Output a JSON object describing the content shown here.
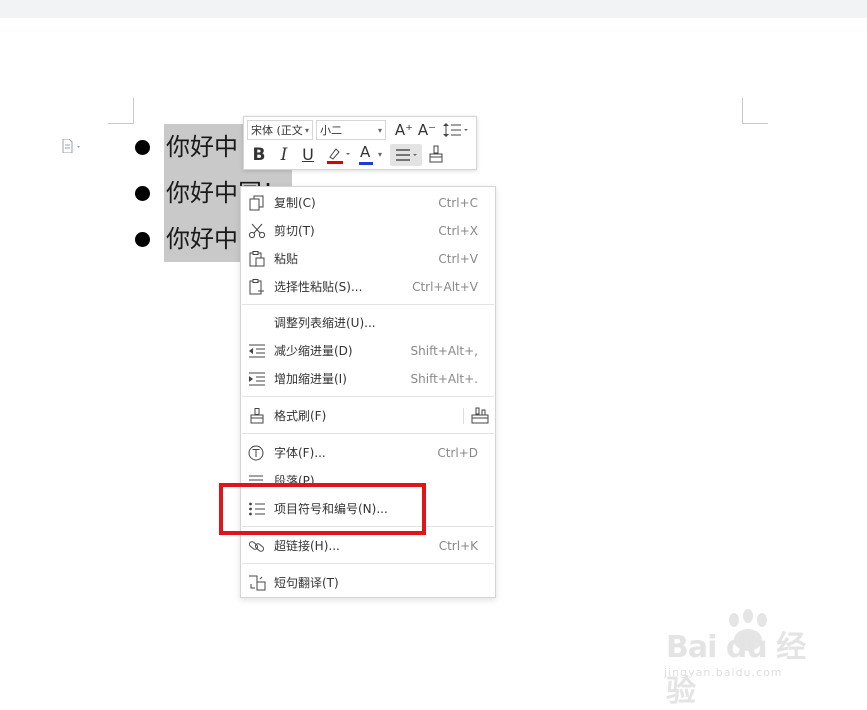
{
  "document": {
    "bullet_items": [
      "你好中",
      "你好中国！",
      "你好中"
    ]
  },
  "mini_toolbar": {
    "font_name": "宋体 (正文",
    "font_size": "小二",
    "grow_font_icon": "A⁺",
    "shrink_font_icon": "A⁻",
    "bold": "B",
    "italic": "I",
    "underline": "U",
    "font_color_letter": "A",
    "highlight_color": "#e00000",
    "font_color": "#1f3ad6"
  },
  "context_menu": {
    "items": [
      {
        "label": "复制(C)",
        "shortcut": "Ctrl+C",
        "icon": "copy-icon"
      },
      {
        "label": "剪切(T)",
        "shortcut": "Ctrl+X",
        "icon": "scissors-icon"
      },
      {
        "label": "粘贴",
        "shortcut": "Ctrl+V",
        "icon": "paste-icon"
      },
      {
        "label": "选择性粘贴(S)...",
        "shortcut": "Ctrl+Alt+V",
        "icon": "paste-special-icon"
      },
      {
        "label": "调整列表缩进(U)...",
        "shortcut": "",
        "icon": ""
      },
      {
        "label": "减少缩进量(D)",
        "shortcut": "Shift+Alt+,",
        "icon": "decrease-indent-icon"
      },
      {
        "label": "增加缩进量(I)",
        "shortcut": "Shift+Alt+.",
        "icon": "increase-indent-icon"
      },
      {
        "label": "格式刷(F)",
        "shortcut": "",
        "icon": "format-painter-icon"
      },
      {
        "label": "字体(F)...",
        "shortcut": "Ctrl+D",
        "icon": "font-icon"
      },
      {
        "label": "段落(P)...",
        "shortcut": "",
        "icon": "paragraph-icon"
      },
      {
        "label": "项目符号和编号(N)...",
        "shortcut": "",
        "icon": "bullets-numbering-icon"
      },
      {
        "label": "超链接(H)...",
        "shortcut": "Ctrl+K",
        "icon": "hyperlink-icon"
      },
      {
        "label": "短句翻译(T)",
        "shortcut": "",
        "icon": "translate-icon"
      }
    ]
  },
  "highlight": {
    "color": "#e0141b",
    "target": "项目符号和编号(N)..."
  },
  "watermark": {
    "main": "Bai du 经验",
    "sub": "jingyan.baidu.com"
  }
}
